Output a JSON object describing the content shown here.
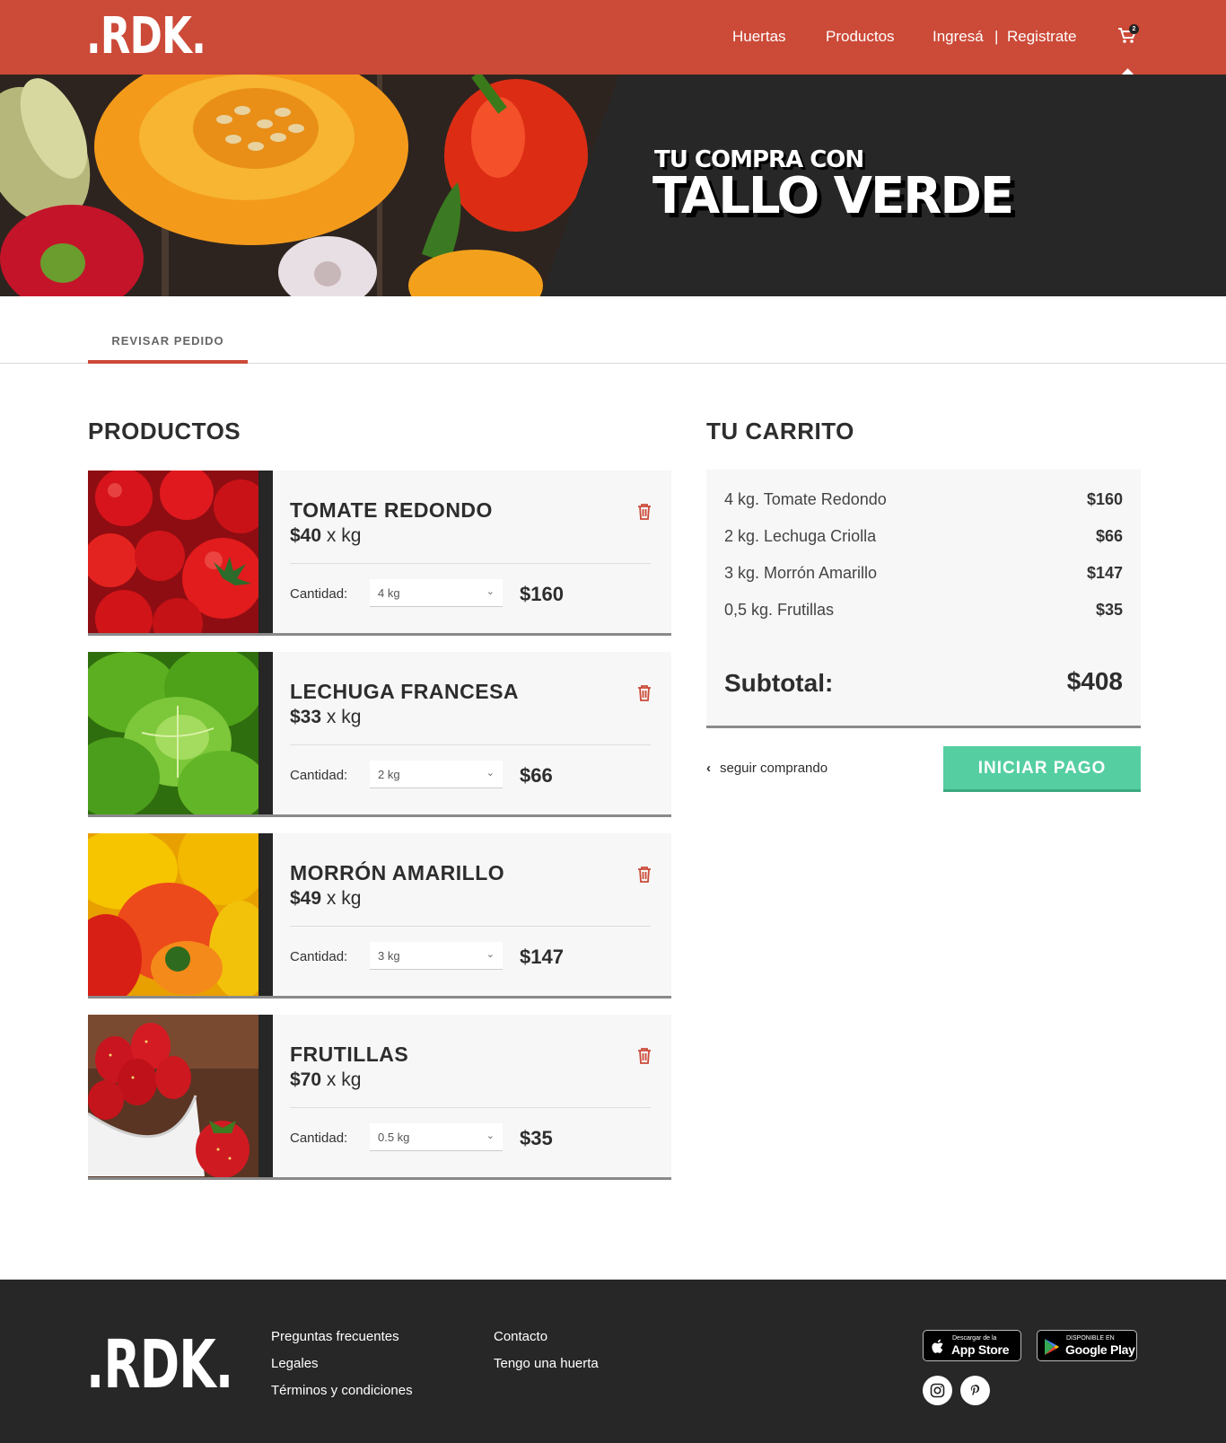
{
  "nav": {
    "logo": ".RDK.",
    "links": [
      "Huertas",
      "Productos",
      "Ingresá",
      "|",
      "Registrate"
    ],
    "cart_count": "2"
  },
  "hero": {
    "subtitle": "TU COMPRA CON",
    "title": "TALLO VERDE"
  },
  "tabs": [
    {
      "label": "REVISAR PEDIDO",
      "active": true
    }
  ],
  "products_section": {
    "title": "PRODUCTOS",
    "quantity_label": "Cantidad:",
    "items": [
      {
        "name": "TOMATE REDONDO",
        "price": "$40",
        "unit": "x kg",
        "quantity": "4 kg",
        "total": "$160",
        "image": "tomatoes",
        "accent": "#c8141c"
      },
      {
        "name": "LECHUGA FRANCESA",
        "price": "$33",
        "unit": "x kg",
        "quantity": "2 kg",
        "total": "$66",
        "image": "lettuce",
        "accent": "#4e9b1e"
      },
      {
        "name": "MORRÓN AMARILLO",
        "price": "$49",
        "unit": "x kg",
        "quantity": "3 kg",
        "total": "$147",
        "image": "yellow-peppers",
        "accent": "#f0b000"
      },
      {
        "name": "FRUTILLAS",
        "price": "$70",
        "unit": "x kg",
        "quantity": "0.5 kg",
        "total": "$35",
        "image": "strawberries",
        "accent": "#b8141c"
      }
    ]
  },
  "cart": {
    "title": "TU CARRITO",
    "lines": [
      {
        "desc": "4 kg.  Tomate Redondo",
        "amount": "$160"
      },
      {
        "desc": "2 kg.  Lechuga Criolla",
        "amount": "$66"
      },
      {
        "desc": "3 kg.  Morrón Amarillo",
        "amount": "$147"
      },
      {
        "desc": "0,5 kg.  Frutillas",
        "amount": "$35"
      }
    ],
    "subtotal_label": "Subtotal:",
    "subtotal_value": "$408",
    "continue_label": "seguir comprando",
    "pay_label": "INICIAR PAGO"
  },
  "footer": {
    "logo": ".RDK.",
    "col1": [
      "Preguntas frecuentes",
      "Legales",
      "Términos y condiciones"
    ],
    "col2": [
      "Contacto",
      "Tengo una huerta"
    ],
    "app_store": {
      "small": "Descargar de la",
      "big": "App Store"
    },
    "google_play": {
      "small": "DISPONIBLE EN",
      "big": "Google Play"
    },
    "social": [
      "instagram-icon",
      "pinterest-icon"
    ]
  },
  "colors": {
    "brand": "#cc4a38",
    "dark": "#272727",
    "accent_button": "#55cfa2",
    "trash": "#cc4a38"
  }
}
